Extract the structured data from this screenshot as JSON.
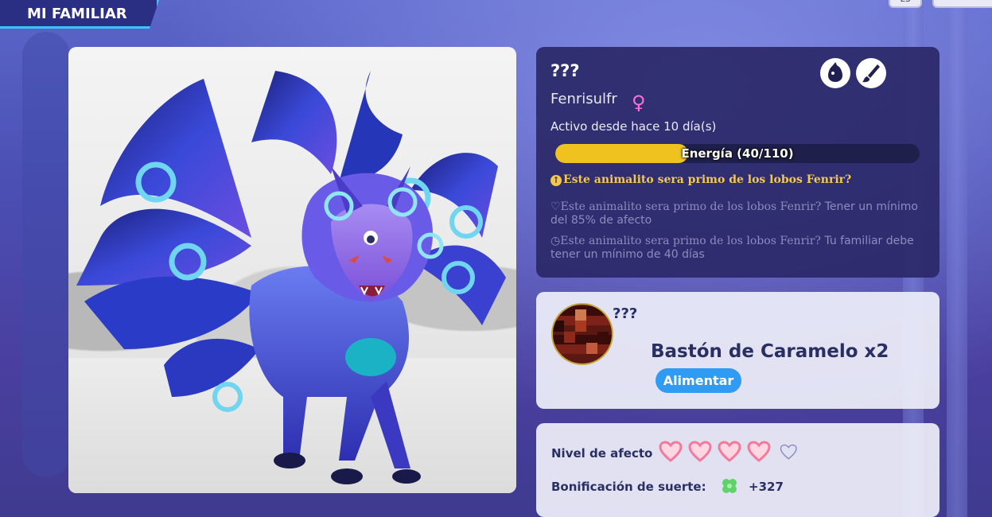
{
  "header": {
    "section_title": "MI FAMILIAR",
    "lang_label": "ES"
  },
  "pet": {
    "name": "???",
    "species": "Fenrisulfr",
    "gender_symbol": "♀",
    "active_text": "Activo desde hace 10 día(s)",
    "energy": {
      "label": "Energía (40/110)",
      "current": 40,
      "max": 110
    },
    "quest_title": "Este animalito sera primo de los lobos Fenrir?",
    "quest_affection_prefix": "Este animalito sera primo de los lobos Fenrir?",
    "quest_affection_text": " Tener un mínimo del 85% de afecto",
    "quest_age_prefix": "Este animalito sera primo de los lobos Fenrir?",
    "quest_age_text": " Tu familiar debe tener un mínimo de 40 días",
    "icons": [
      "egg-icon",
      "brush-icon"
    ]
  },
  "feeding": {
    "food_unknown_label": "???",
    "food_name": "Bastón de Caramelo x2",
    "feed_button": "Alimentar"
  },
  "stats": {
    "affection_label": "Nivel de afecto",
    "affection_filled": 4,
    "affection_total": 5,
    "luck_label": "Bonificación de suerte:",
    "luck_value": "+327"
  },
  "colors": {
    "accent_blue": "#38c6ff",
    "energy_yellow": "#f0c21f",
    "quest_gold": "#f2c94c",
    "feed_button": "#2f9bf2",
    "heart_pink": "#f27a9b",
    "gender_pink": "#ff6fd8"
  }
}
